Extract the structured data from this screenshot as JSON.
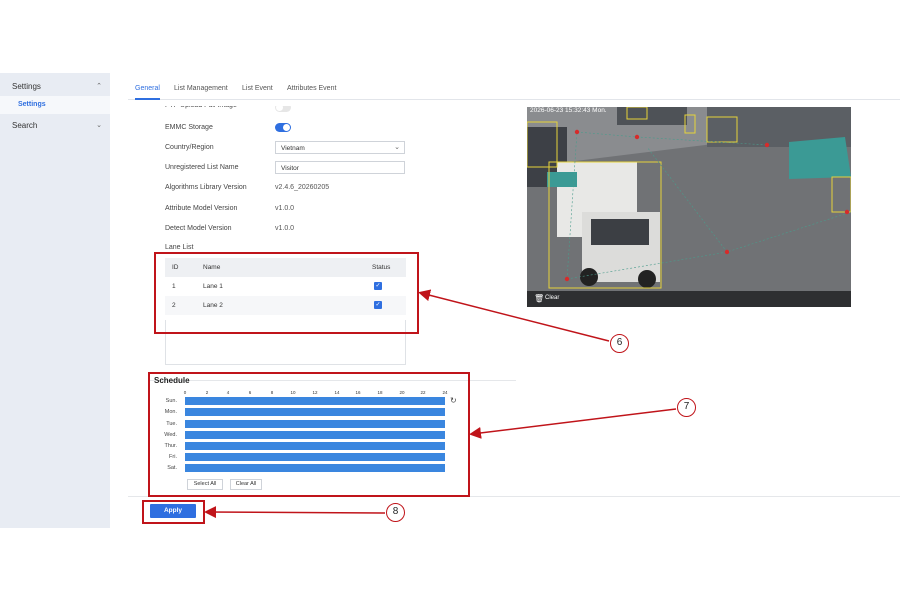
{
  "sidebar": {
    "items": [
      {
        "label": "Settings",
        "icon": "chevron-up-icon",
        "chevron": "⌃"
      },
      {
        "label": "Search",
        "icon": "chevron-down-icon",
        "chevron": "⌄"
      }
    ],
    "sub_item": "Settings"
  },
  "tabs": [
    "General",
    "List Management",
    "List Event",
    "Attributes Event"
  ],
  "active_tab": "General",
  "form": {
    "ftp_label": "FTP Upload Full Image",
    "ftp_enabled": false,
    "emmc_label": "EMMC Storage",
    "emmc_enabled": true,
    "country_label": "Country/Region",
    "country_value": "Vietnam",
    "unregistered_label": "Unregistered List Name",
    "unregistered_value": "Visitor",
    "algo_label": "Algorithms Library Version",
    "algo_value": "v2.4.6_20260205",
    "attr_model_label": "Attribute Model Version",
    "attr_model_value": "v1.0.0",
    "detect_model_label": "Detect Model Version",
    "detect_model_value": "v1.0.0",
    "lane_list_label": "Lane List"
  },
  "lane_table": {
    "headers": [
      "ID",
      "Name",
      "Status"
    ],
    "rows": [
      {
        "id": "1",
        "name": "Lane 1",
        "checked": true
      },
      {
        "id": "2",
        "name": "Lane 2",
        "checked": true
      }
    ]
  },
  "camera": {
    "timestamp": "2026-06-23 15:32:43 Mon.",
    "clear_label": "Clear"
  },
  "schedule": {
    "title": "Schedule",
    "hours": [
      "0",
      "2",
      "4",
      "6",
      "8",
      "10",
      "12",
      "14",
      "16",
      "18",
      "20",
      "22",
      "24"
    ],
    "days": [
      "Sun.",
      "Mon.",
      "Tue.",
      "Wed.",
      "Thur.",
      "Fri.",
      "Sat."
    ],
    "select_all": "Select All",
    "clear_all": "Clear All"
  },
  "apply_label": "Apply",
  "annotations": [
    "6",
    "7",
    "8"
  ],
  "colors": {
    "accent": "#2f6fe0",
    "annotation": "#c0141a",
    "schedule_bar": "#3a86df"
  }
}
